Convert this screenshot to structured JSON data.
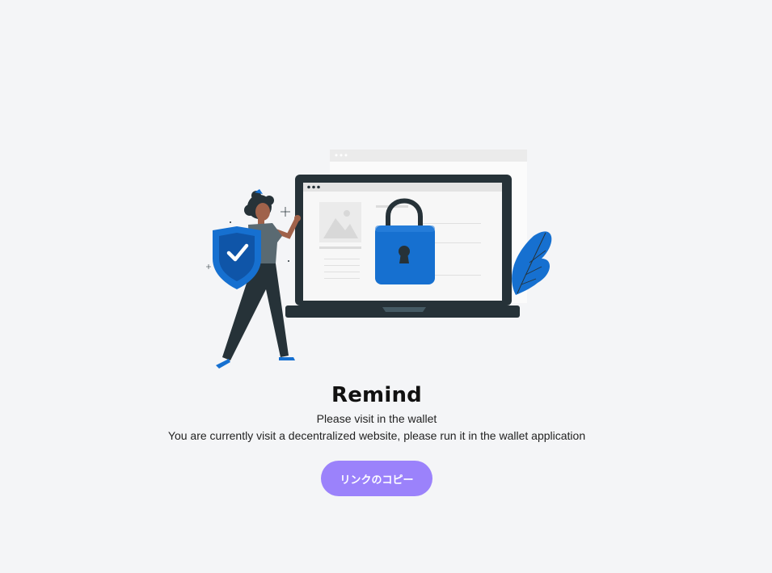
{
  "dialog": {
    "title": "Remind",
    "subtitle": "Please visit in the wallet",
    "description": "You are currently visit a decentralized website, please run it in the wallet application",
    "copy_button_label": "リンクのコピー"
  },
  "colors": {
    "background": "#f4f5f7",
    "button": "#9b82fb",
    "accent_blue": "#1670d0",
    "dark": "#263238"
  },
  "illustration": {
    "icons": [
      "person-figure",
      "shield-check-icon",
      "laptop-icon",
      "padlock-icon",
      "image-placeholder-icon",
      "leaf-decoration"
    ]
  }
}
